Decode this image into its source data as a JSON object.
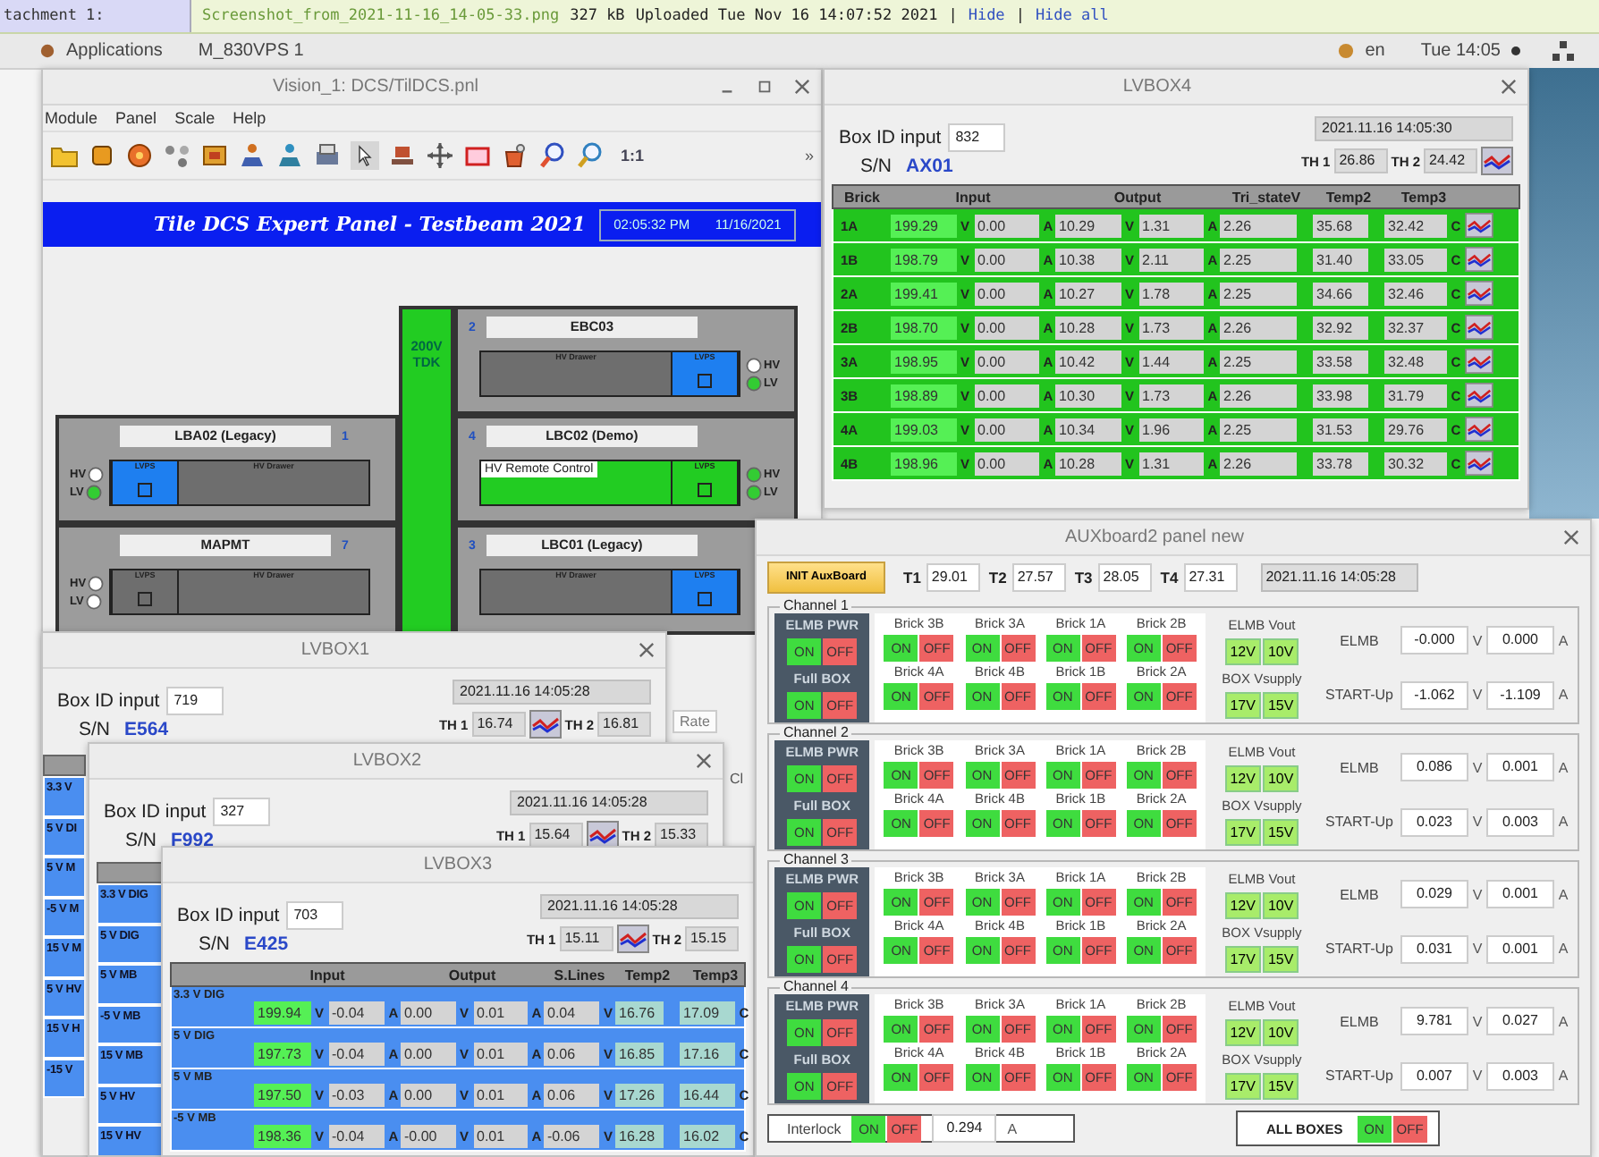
{
  "attachment_bar": {
    "label": "tachment 1:",
    "file": "Screenshot_from_2021-11-16_14-05-33.png",
    "size": "327 kB",
    "uploaded": "Uploaded Tue Nov 16 14:07:52 2021",
    "actions": [
      {
        "kind": "sep",
        "text": "|"
      },
      {
        "kind": "link",
        "text": "Hide"
      },
      {
        "kind": "sep",
        "text": "|"
      },
      {
        "kind": "link",
        "text": "Hide all"
      }
    ]
  },
  "top_bar": {
    "applications": "Applications",
    "window": "M_830VPS 1",
    "lang": "en",
    "clock": "Tue 14:05"
  },
  "vision": {
    "title": "Vision_1: DCS/TilDCS.pnl",
    "menu": [
      "Module",
      "Panel",
      "Scale",
      "Help"
    ],
    "zoom_label": "1:1",
    "overflow": "»",
    "banner": {
      "title": "Tile DCS Expert Panel - Testbeam 2021",
      "time": "02:05:32 PM",
      "date": "11/16/2021"
    },
    "supply_lines": [
      "200V",
      "TDK"
    ],
    "left_modules": [
      {
        "name": "LBA02 (Legacy)",
        "number": "1",
        "lvps_label": "LVPS",
        "drawer_label": "HV Drawer",
        "lvps_on": true,
        "remote": false,
        "hv_label": "HV",
        "lv_label": "LV",
        "hv": false,
        "lv": true
      },
      {
        "name": "MAPMT",
        "number": "7",
        "lvps_label": "LVPS",
        "drawer_label": "HV Drawer",
        "lvps_on": false,
        "remote": false,
        "hv_label": "HV",
        "lv_label": "LV",
        "hv": false,
        "lv": false
      }
    ],
    "right_modules": [
      {
        "name": "EBC03",
        "number": "2",
        "lvps_label": "LVPS",
        "drawer_label": "HV Drawer",
        "lvps_on": true,
        "remote": false,
        "hv_label": "HV",
        "lv_label": "LV",
        "hv": false,
        "lv": true
      },
      {
        "name": "LBC02 (Demo)",
        "number": "4",
        "lvps_label": "LVPS",
        "overlay_label": "HV Remote Control",
        "remote": true,
        "hv_label": "HV",
        "lv_label": "LV",
        "hv": true,
        "lv": true
      },
      {
        "name": "LBC01 (Legacy)",
        "number": "3",
        "lvps_label": "LVPS",
        "drawer_label": "HV Drawer",
        "lvps_on": true,
        "remote": false
      }
    ],
    "side_buttons": [
      "Rate",
      "Cl"
    ]
  },
  "lvbox4": {
    "title": "LVBOX4",
    "kind": "brick",
    "box_id_label": "Box ID input",
    "box_id": "832",
    "sn_label": "S/N",
    "sn": "AX01",
    "timestamp": "2021.11.16 14:05:30",
    "th1_label": "TH 1",
    "th1": "26.86",
    "th2_label": "TH 2",
    "th2": "24.42",
    "label_heading": "Brick",
    "columns": [
      "Input",
      "Output",
      "Tri_stateV",
      "Temp2",
      "Temp3"
    ],
    "row_chart": true,
    "rows": [
      {
        "label": "1A",
        "cells": [
          [
            {
              "value": "199.29",
              "unit": "V",
              "kind": "input"
            },
            {
              "value": "0.00",
              "unit": "A"
            }
          ],
          [
            {
              "value": "10.29",
              "unit": "V"
            },
            {
              "value": "1.31",
              "unit": "A"
            }
          ],
          [
            {
              "value": "2.26"
            }
          ],
          [
            {
              "value": "35.68"
            }
          ],
          [
            {
              "value": "32.42",
              "unit": "C"
            }
          ]
        ]
      },
      {
        "label": "1B",
        "cells": [
          [
            {
              "value": "198.79",
              "unit": "V",
              "kind": "input"
            },
            {
              "value": "0.00",
              "unit": "A"
            }
          ],
          [
            {
              "value": "10.38",
              "unit": "V"
            },
            {
              "value": "2.11",
              "unit": "A"
            }
          ],
          [
            {
              "value": "2.25"
            }
          ],
          [
            {
              "value": "31.40"
            }
          ],
          [
            {
              "value": "33.05",
              "unit": "C"
            }
          ]
        ]
      },
      {
        "label": "2A",
        "cells": [
          [
            {
              "value": "199.41",
              "unit": "V",
              "kind": "input"
            },
            {
              "value": "0.00",
              "unit": "A"
            }
          ],
          [
            {
              "value": "10.27",
              "unit": "V"
            },
            {
              "value": "1.78",
              "unit": "A"
            }
          ],
          [
            {
              "value": "2.25"
            }
          ],
          [
            {
              "value": "34.66"
            }
          ],
          [
            {
              "value": "32.46",
              "unit": "C"
            }
          ]
        ]
      },
      {
        "label": "2B",
        "cells": [
          [
            {
              "value": "198.70",
              "unit": "V",
              "kind": "input"
            },
            {
              "value": "0.00",
              "unit": "A"
            }
          ],
          [
            {
              "value": "10.28",
              "unit": "V"
            },
            {
              "value": "1.73",
              "unit": "A"
            }
          ],
          [
            {
              "value": "2.26"
            }
          ],
          [
            {
              "value": "32.92"
            }
          ],
          [
            {
              "value": "32.37",
              "unit": "C"
            }
          ]
        ]
      },
      {
        "label": "3A",
        "cells": [
          [
            {
              "value": "198.95",
              "unit": "V",
              "kind": "input"
            },
            {
              "value": "0.00",
              "unit": "A"
            }
          ],
          [
            {
              "value": "10.42",
              "unit": "V"
            },
            {
              "value": "1.44",
              "unit": "A"
            }
          ],
          [
            {
              "value": "2.25"
            }
          ],
          [
            {
              "value": "33.58"
            }
          ],
          [
            {
              "value": "32.48",
              "unit": "C"
            }
          ]
        ]
      },
      {
        "label": "3B",
        "cells": [
          [
            {
              "value": "198.89",
              "unit": "V",
              "kind": "input"
            },
            {
              "value": "0.00",
              "unit": "A"
            }
          ],
          [
            {
              "value": "10.30",
              "unit": "V"
            },
            {
              "value": "1.73",
              "unit": "A"
            }
          ],
          [
            {
              "value": "2.26"
            }
          ],
          [
            {
              "value": "33.98"
            }
          ],
          [
            {
              "value": "31.79",
              "unit": "C"
            }
          ]
        ]
      },
      {
        "label": "4A",
        "cells": [
          [
            {
              "value": "199.03",
              "unit": "V",
              "kind": "input"
            },
            {
              "value": "0.00",
              "unit": "A"
            }
          ],
          [
            {
              "value": "10.34",
              "unit": "V"
            },
            {
              "value": "1.96",
              "unit": "A"
            }
          ],
          [
            {
              "value": "2.25"
            }
          ],
          [
            {
              "value": "31.53"
            }
          ],
          [
            {
              "value": "29.76",
              "unit": "C"
            }
          ]
        ]
      },
      {
        "label": "4B",
        "cells": [
          [
            {
              "value": "198.96",
              "unit": "V",
              "kind": "input"
            },
            {
              "value": "0.00",
              "unit": "A"
            }
          ],
          [
            {
              "value": "10.28",
              "unit": "V"
            },
            {
              "value": "1.31",
              "unit": "A"
            }
          ],
          [
            {
              "value": "2.26"
            }
          ],
          [
            {
              "value": "33.78"
            }
          ],
          [
            {
              "value": "30.32",
              "unit": "C"
            }
          ]
        ]
      }
    ]
  },
  "lvbox1": {
    "title": "LVBOX1",
    "kind": "supply",
    "box_id_label": "Box ID input",
    "box_id": "719",
    "sn_label": "S/N",
    "sn": "E564",
    "timestamp": "2021.11.16 14:05:28",
    "th1_label": "TH 1",
    "th1": "16.74",
    "th2_label": "TH 2",
    "th2": "16.81",
    "row_labels": [
      "3.3 V",
      "5 V DI",
      "5 V M",
      "-5 V M",
      "15 V M",
      "5 V HV",
      "15 V H",
      "-15 V"
    ]
  },
  "lvbox2": {
    "title": "LVBOX2",
    "kind": "supply",
    "box_id_label": "Box ID input",
    "box_id": "327",
    "sn_label": "S/N",
    "sn": "F992",
    "timestamp": "2021.11.16 14:05:28",
    "th1_label": "TH 1",
    "th1": "15.64",
    "th2_label": "TH 2",
    "th2": "15.33",
    "row_labels": [
      "3.3 V DIG",
      "5 V DIG",
      "5 V MB",
      "-5 V MB",
      "15 V MB",
      "5 V HV",
      "15 V HV"
    ]
  },
  "lvbox3": {
    "title": "LVBOX3",
    "kind": "supply",
    "box_id_label": "Box ID input",
    "box_id": "703",
    "sn_label": "S/N",
    "sn": "E425",
    "timestamp": "2021.11.16 14:05:28",
    "th1_label": "TH 1",
    "th1": "15.11",
    "th2_label": "TH 2",
    "th2": "15.15",
    "columns": [
      "Input",
      "Output",
      "S.Lines",
      "Temp2",
      "Temp3"
    ],
    "rows": [
      {
        "label": "3.3 V DIG",
        "cells": [
          [
            {
              "value": "199.94",
              "unit": "V",
              "kind": "input"
            },
            {
              "value": "-0.04",
              "unit": "A"
            }
          ],
          [
            {
              "value": "0.00",
              "unit": "V"
            },
            {
              "value": "0.01",
              "unit": "A"
            }
          ],
          [
            {
              "value": "0.04",
              "unit": "V"
            }
          ],
          [
            {
              "value": "16.76",
              "kind": "temp"
            }
          ],
          [
            {
              "value": "17.09",
              "unit": "C",
              "kind": "temp"
            }
          ]
        ]
      },
      {
        "label": "5 V DIG",
        "cells": [
          [
            {
              "value": "197.73",
              "unit": "V",
              "kind": "input"
            },
            {
              "value": "-0.04",
              "unit": "A"
            }
          ],
          [
            {
              "value": "0.00",
              "unit": "V"
            },
            {
              "value": "0.01",
              "unit": "A"
            }
          ],
          [
            {
              "value": "0.06",
              "unit": "V"
            }
          ],
          [
            {
              "value": "16.85",
              "kind": "temp"
            }
          ],
          [
            {
              "value": "17.16",
              "unit": "C",
              "kind": "temp"
            }
          ]
        ]
      },
      {
        "label": "5 V MB",
        "cells": [
          [
            {
              "value": "197.50",
              "unit": "V",
              "kind": "input"
            },
            {
              "value": "-0.03",
              "unit": "A"
            }
          ],
          [
            {
              "value": "0.00",
              "unit": "V"
            },
            {
              "value": "0.01",
              "unit": "A"
            }
          ],
          [
            {
              "value": "0.06",
              "unit": "V"
            }
          ],
          [
            {
              "value": "17.26",
              "kind": "temp"
            }
          ],
          [
            {
              "value": "16.44",
              "unit": "C",
              "kind": "temp"
            }
          ]
        ]
      },
      {
        "label": "-5 V MB",
        "cells": [
          [
            {
              "value": "198.36",
              "unit": "V",
              "kind": "input"
            },
            {
              "value": "-0.04",
              "unit": "A"
            }
          ],
          [
            {
              "value": "-0.00",
              "unit": "V"
            },
            {
              "value": "0.01",
              "unit": "A"
            }
          ],
          [
            {
              "value": "-0.06",
              "unit": "V"
            }
          ],
          [
            {
              "value": "16.28",
              "kind": "temp"
            }
          ],
          [
            {
              "value": "16.02",
              "unit": "C",
              "kind": "temp"
            }
          ]
        ]
      }
    ]
  },
  "aux": {
    "title": "AUXboard2 panel new",
    "init_button": "INIT AuxBoard",
    "temps": [
      {
        "label": "T1",
        "value": "29.01"
      },
      {
        "label": "T2",
        "value": "27.57"
      },
      {
        "label": "T3",
        "value": "28.05"
      },
      {
        "label": "T4",
        "value": "27.31"
      }
    ],
    "timestamp": "2021.11.16 14:05:28",
    "channels": [
      {
        "legend": "Channel 1",
        "pwr": [
          {
            "label": "ELMB PWR",
            "switch": [
              "ON",
              "OFF"
            ]
          },
          {
            "label": "Full BOX",
            "switch": [
              "ON",
              "OFF"
            ]
          }
        ],
        "bricks": [
          {
            "label": "Brick 3B",
            "switch": [
              "ON",
              "OFF"
            ]
          },
          {
            "label": "Brick 3A",
            "switch": [
              "ON",
              "OFF"
            ]
          },
          {
            "label": "Brick 1A",
            "switch": [
              "ON",
              "OFF"
            ]
          },
          {
            "label": "Brick 2B",
            "switch": [
              "ON",
              "OFF"
            ]
          },
          {
            "label": "Brick 4A",
            "switch": [
              "ON",
              "OFF"
            ]
          },
          {
            "label": "Brick 4B",
            "switch": [
              "ON",
              "OFF"
            ]
          },
          {
            "label": "Brick 1B",
            "switch": [
              "ON",
              "OFF"
            ]
          },
          {
            "label": "Brick 2A",
            "switch": [
              "ON",
              "OFF"
            ]
          }
        ],
        "vout": [
          {
            "label": "ELMB Vout",
            "options": [
              "12V",
              "10V"
            ]
          },
          {
            "label": "BOX Vsupply",
            "options": [
              "17V",
              "15V"
            ]
          }
        ],
        "readings": [
          {
            "label": "ELMB",
            "v": "-0.000",
            "v_unit": "V",
            "a": "0.000",
            "a_unit": "A"
          },
          {
            "label": "START-Up",
            "v": "-1.062",
            "v_unit": "V",
            "a": "-1.109",
            "a_unit": "A"
          }
        ]
      },
      {
        "legend": "Channel 2",
        "pwr": [
          {
            "label": "ELMB PWR",
            "switch": [
              "ON",
              "OFF"
            ]
          },
          {
            "label": "Full BOX",
            "switch": [
              "ON",
              "OFF"
            ]
          }
        ],
        "bricks": [
          {
            "label": "Brick 3B",
            "switch": [
              "ON",
              "OFF"
            ]
          },
          {
            "label": "Brick 3A",
            "switch": [
              "ON",
              "OFF"
            ]
          },
          {
            "label": "Brick 1A",
            "switch": [
              "ON",
              "OFF"
            ]
          },
          {
            "label": "Brick 2B",
            "switch": [
              "ON",
              "OFF"
            ]
          },
          {
            "label": "Brick 4A",
            "switch": [
              "ON",
              "OFF"
            ]
          },
          {
            "label": "Brick 4B",
            "switch": [
              "ON",
              "OFF"
            ]
          },
          {
            "label": "Brick 1B",
            "switch": [
              "ON",
              "OFF"
            ]
          },
          {
            "label": "Brick 2A",
            "switch": [
              "ON",
              "OFF"
            ]
          }
        ],
        "vout": [
          {
            "label": "ELMB Vout",
            "options": [
              "12V",
              "10V"
            ]
          },
          {
            "label": "BOX Vsupply",
            "options": [
              "17V",
              "15V"
            ]
          }
        ],
        "readings": [
          {
            "label": "ELMB",
            "v": "0.086",
            "v_unit": "V",
            "a": "0.001",
            "a_unit": "A"
          },
          {
            "label": "START-Up",
            "v": "0.023",
            "v_unit": "V",
            "a": "0.003",
            "a_unit": "A"
          }
        ]
      },
      {
        "legend": "Channel 3",
        "pwr": [
          {
            "label": "ELMB PWR",
            "switch": [
              "ON",
              "OFF"
            ]
          },
          {
            "label": "Full BOX",
            "switch": [
              "ON",
              "OFF"
            ]
          }
        ],
        "bricks": [
          {
            "label": "Brick 3B",
            "switch": [
              "ON",
              "OFF"
            ]
          },
          {
            "label": "Brick 3A",
            "switch": [
              "ON",
              "OFF"
            ]
          },
          {
            "label": "Brick 1A",
            "switch": [
              "ON",
              "OFF"
            ]
          },
          {
            "label": "Brick 2B",
            "switch": [
              "ON",
              "OFF"
            ]
          },
          {
            "label": "Brick 4A",
            "switch": [
              "ON",
              "OFF"
            ]
          },
          {
            "label": "Brick 4B",
            "switch": [
              "ON",
              "OFF"
            ]
          },
          {
            "label": "Brick 1B",
            "switch": [
              "ON",
              "OFF"
            ]
          },
          {
            "label": "Brick 2A",
            "switch": [
              "ON",
              "OFF"
            ]
          }
        ],
        "vout": [
          {
            "label": "ELMB Vout",
            "options": [
              "12V",
              "10V"
            ]
          },
          {
            "label": "BOX Vsupply",
            "options": [
              "17V",
              "15V"
            ]
          }
        ],
        "readings": [
          {
            "label": "ELMB",
            "v": "0.029",
            "v_unit": "V",
            "a": "0.001",
            "a_unit": "A"
          },
          {
            "label": "START-Up",
            "v": "0.031",
            "v_unit": "V",
            "a": "0.001",
            "a_unit": "A"
          }
        ]
      },
      {
        "legend": "Channel 4",
        "pwr": [
          {
            "label": "ELMB PWR",
            "switch": [
              "ON",
              "OFF"
            ]
          },
          {
            "label": "Full BOX",
            "switch": [
              "ON",
              "OFF"
            ]
          }
        ],
        "bricks": [
          {
            "label": "Brick 3B",
            "switch": [
              "ON",
              "OFF"
            ]
          },
          {
            "label": "Brick 3A",
            "switch": [
              "ON",
              "OFF"
            ]
          },
          {
            "label": "Brick 1A",
            "switch": [
              "ON",
              "OFF"
            ]
          },
          {
            "label": "Brick 2B",
            "switch": [
              "ON",
              "OFF"
            ]
          },
          {
            "label": "Brick 4A",
            "switch": [
              "ON",
              "OFF"
            ]
          },
          {
            "label": "Brick 4B",
            "switch": [
              "ON",
              "OFF"
            ]
          },
          {
            "label": "Brick 1B",
            "switch": [
              "ON",
              "OFF"
            ]
          },
          {
            "label": "Brick 2A",
            "switch": [
              "ON",
              "OFF"
            ]
          }
        ],
        "vout": [
          {
            "label": "ELMB Vout",
            "options": [
              "12V",
              "10V"
            ]
          },
          {
            "label": "BOX Vsupply",
            "options": [
              "17V",
              "15V"
            ]
          }
        ],
        "readings": [
          {
            "label": "ELMB",
            "v": "9.781",
            "v_unit": "V",
            "a": "0.027",
            "a_unit": "A"
          },
          {
            "label": "START-Up",
            "v": "0.007",
            "v_unit": "V",
            "a": "0.003",
            "a_unit": "A"
          }
        ]
      }
    ],
    "interlock": {
      "label": "Interlock",
      "switch": [
        "ON",
        "OFF"
      ],
      "value": "0.294",
      "unit": "A"
    },
    "all_boxes": {
      "label": "ALL BOXES",
      "switch": [
        "ON",
        "OFF"
      ]
    }
  }
}
